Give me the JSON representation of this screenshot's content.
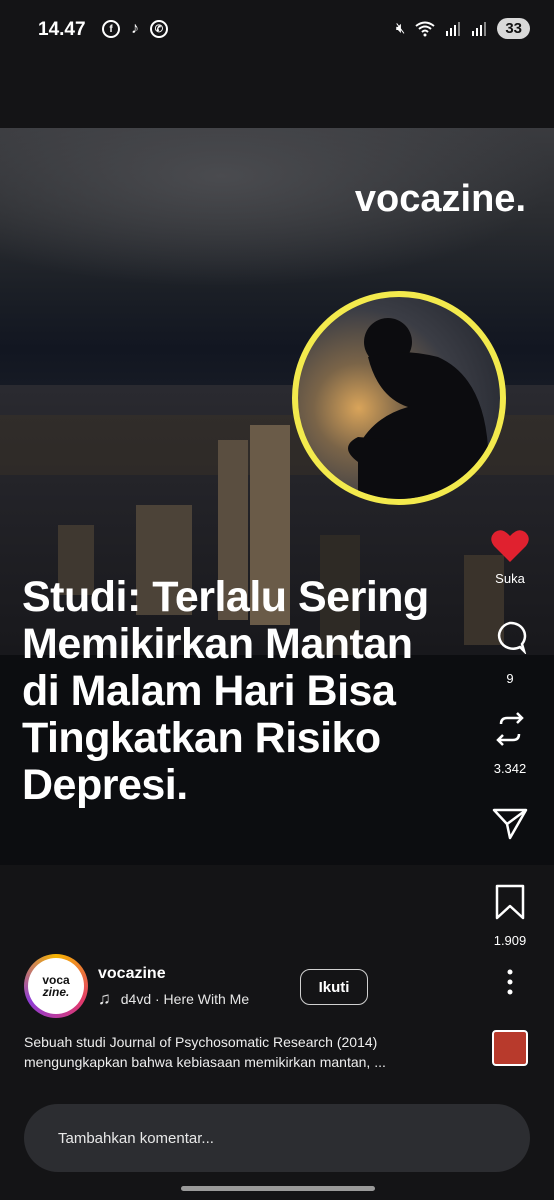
{
  "status_bar": {
    "time": "14.47",
    "app_icons": [
      "facebook-icon",
      "tiktok-icon",
      "whatsapp-icon"
    ],
    "battery": "33"
  },
  "post": {
    "brand": "vocazine.",
    "headline_lines": [
      "Studi: Terlalu Sering",
      "Memikirkan Mantan",
      "di Malam Hari Bisa",
      "Tingkatkan Risiko",
      "Depresi."
    ],
    "accent_color": "#f3ea4d"
  },
  "actions": {
    "like_label": "Suka",
    "comment_count": "9",
    "repost_count": "3.342",
    "save_count": "1.909",
    "like_color": "#e0212f"
  },
  "author": {
    "avatar_text_1": "voca",
    "avatar_text_2": "zine.",
    "username": "vocazine",
    "song": "d4vd · Here With Me",
    "follow_label": "Ikuti"
  },
  "caption_lines": [
    "Sebuah studi Journal of Psychosomatic Research (2014)",
    "mengungkapkan bahwa kebiasaan memikirkan mantan, ..."
  ],
  "comment": {
    "placeholder": "Tambahkan komentar..."
  }
}
